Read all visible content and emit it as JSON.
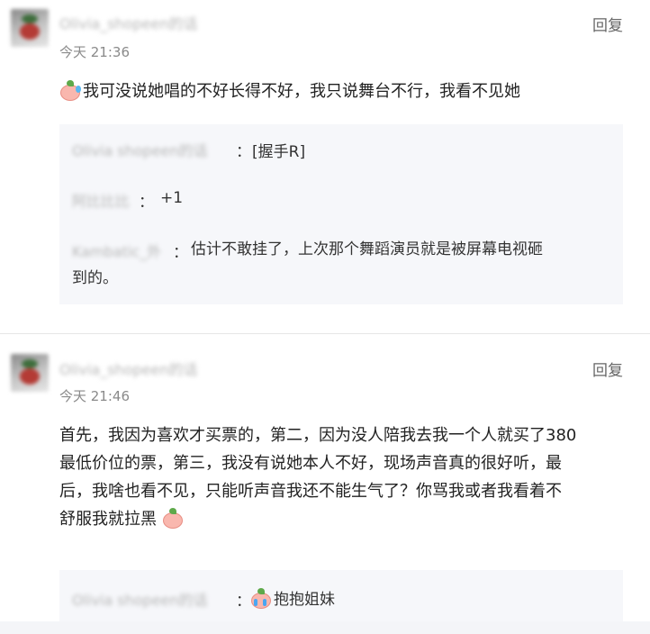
{
  "comments": [
    {
      "username": "Olivia_shopeen的话",
      "time": "今天 21:36",
      "reply_label": "回复",
      "text": "我可没说她唱的不好长得不好，我只说舞台不行，我看不见她",
      "sub_replies": [
        {
          "username": "Olivia shopeen的话",
          "sep": "：",
          "text": "[握手R]"
        },
        {
          "username": "阿比比比",
          "sep": "：",
          "text": "+1"
        },
        {
          "username": "Kambatic_外",
          "sep": "：",
          "text_line1": "估计不敢挂了，上次那个舞蹈演员就是被屏幕电视砸",
          "text_line2": "到的。"
        }
      ]
    },
    {
      "username": "Olivia_shopeen的话",
      "time": "今天 21:46",
      "reply_label": "回复",
      "text_lines": [
        "首先，我因为喜欢才买票的，第二，因为没人陪我去我一个人就买了380",
        "最低价位的票，第三，我没有说她本人不好，现场声音真的很好听，最",
        "后，我啥也看不见，只能听声音我还不能生气了？你骂我或者我看着不",
        "舒服我就拉黑"
      ],
      "sub_replies": [
        {
          "username": "Olivia shopeen的话",
          "sep": "：",
          "text": "抱抱姐妹"
        }
      ]
    }
  ],
  "icons": {
    "emoji_1": "sweat-smile-emoji-icon",
    "emoji_2": "blush-emoji-icon",
    "emoji_3": "crying-emoji-icon"
  },
  "colors": {
    "quote_bg": "#f6f7fa",
    "muted": "#8a8a8a",
    "text": "#222222"
  }
}
